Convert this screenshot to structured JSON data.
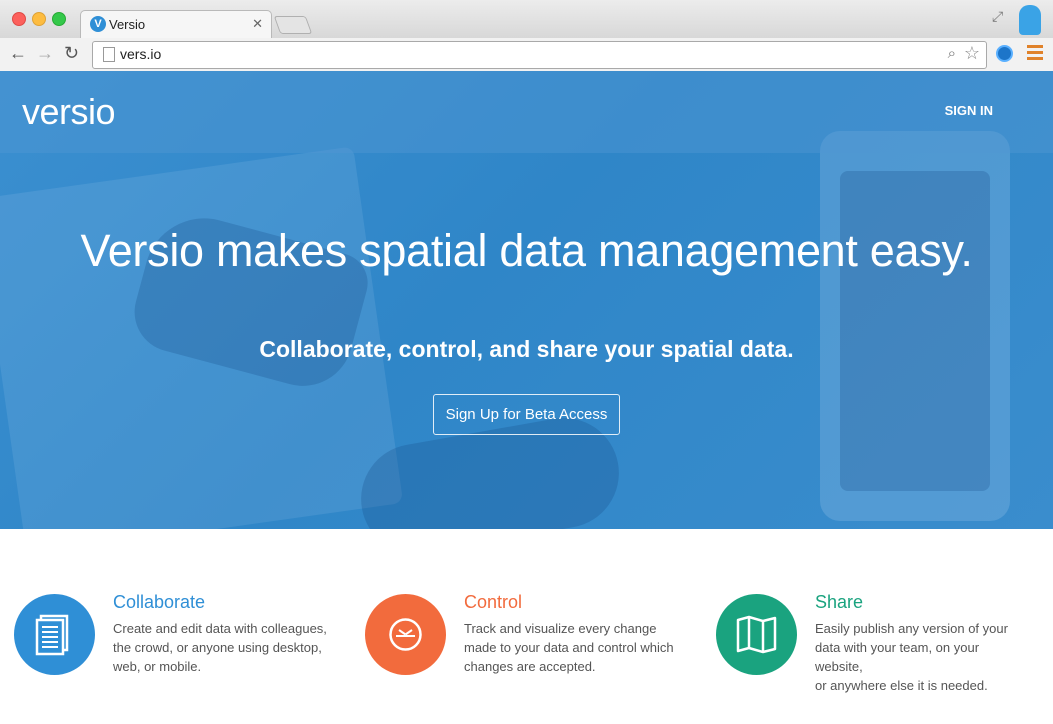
{
  "browser": {
    "tab_title": "Versio",
    "tab_favicon_letter": "V",
    "tab_close": "✕",
    "url": "vers.io"
  },
  "site": {
    "logo": "versio",
    "nav_signin": "SIGN IN",
    "headline": "Versio makes spatial data management easy.",
    "subheadline": "Collaborate, control, and share your spatial data.",
    "cta": "Sign Up for Beta Access"
  },
  "features": [
    {
      "title": "Collaborate",
      "color": "#2f8fd6",
      "icon": "document-icon",
      "line1": "Create and edit data with colleagues,",
      "line2": "the crowd, or anyone using desktop,",
      "line3": "web, or mobile."
    },
    {
      "title": "Control",
      "color": "#f26b3d",
      "icon": "clock-icon",
      "line1": "Track and visualize every change",
      "line2": "made to your data and control which",
      "line3": "changes are accepted."
    },
    {
      "title": "Share",
      "color": "#1aa37f",
      "icon": "map-icon",
      "line1": "Easily publish any version of your",
      "line2": "data with your team, on your website,",
      "line3": "or anywhere else it is needed."
    }
  ]
}
